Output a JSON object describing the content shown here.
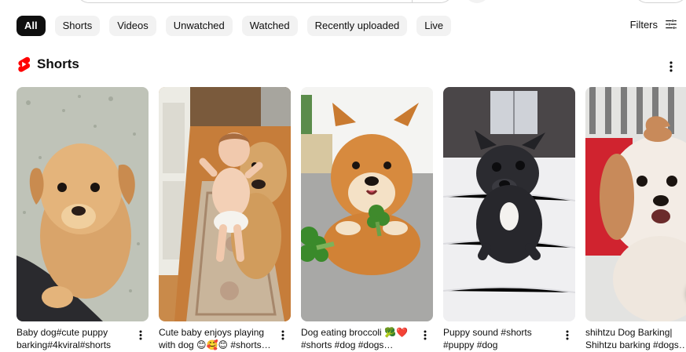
{
  "chips": [
    {
      "label": "All",
      "active": true
    },
    {
      "label": "Shorts",
      "active": false
    },
    {
      "label": "Videos",
      "active": false
    },
    {
      "label": "Unwatched",
      "active": false
    },
    {
      "label": "Watched",
      "active": false
    },
    {
      "label": "Recently uploaded",
      "active": false
    },
    {
      "label": "Live",
      "active": false
    }
  ],
  "filters": {
    "label": "Filters",
    "icon": "tune-icon"
  },
  "shelf": {
    "title": "Shorts",
    "icon": "shorts-logo-icon",
    "accent": "#ff0000"
  },
  "shorts": [
    {
      "title": "Baby dog#cute puppy barking#4kviral#shorts"
    },
    {
      "title": "Cute baby enjoys playing with dog 😊🥰😊 #shorts…"
    },
    {
      "title": "Dog eating broccoli 🥦❤️ #shorts #dog #dogs…"
    },
    {
      "title": "Puppy sound #shorts #puppy #dog"
    },
    {
      "title": "shihtzu Dog Barking| Shihtzu barking #dogs…"
    }
  ]
}
